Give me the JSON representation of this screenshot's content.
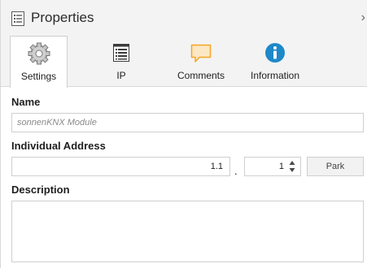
{
  "header": {
    "title": "Properties",
    "icon": "properties-icon",
    "chevron": "›"
  },
  "tabs": [
    {
      "label": "Settings",
      "icon": "gear-icon",
      "active": true
    },
    {
      "label": "IP",
      "icon": "ip-window-icon",
      "active": false
    },
    {
      "label": "Comments",
      "icon": "comment-icon",
      "active": false
    },
    {
      "label": "Information",
      "icon": "info-icon",
      "active": false
    }
  ],
  "form": {
    "name_label": "Name",
    "name_placeholder": "sonnenKNX Module",
    "address_label": "Individual Address",
    "address_prefix": "1.1",
    "address_separator": ".",
    "address_device": "1",
    "park_label": "Park",
    "description_label": "Description",
    "description_value": ""
  },
  "colors": {
    "header_bg": "#f3f3f3",
    "comment_icon": "#f5a623",
    "info_icon": "#1e88c8",
    "border": "#cfcfcf"
  }
}
